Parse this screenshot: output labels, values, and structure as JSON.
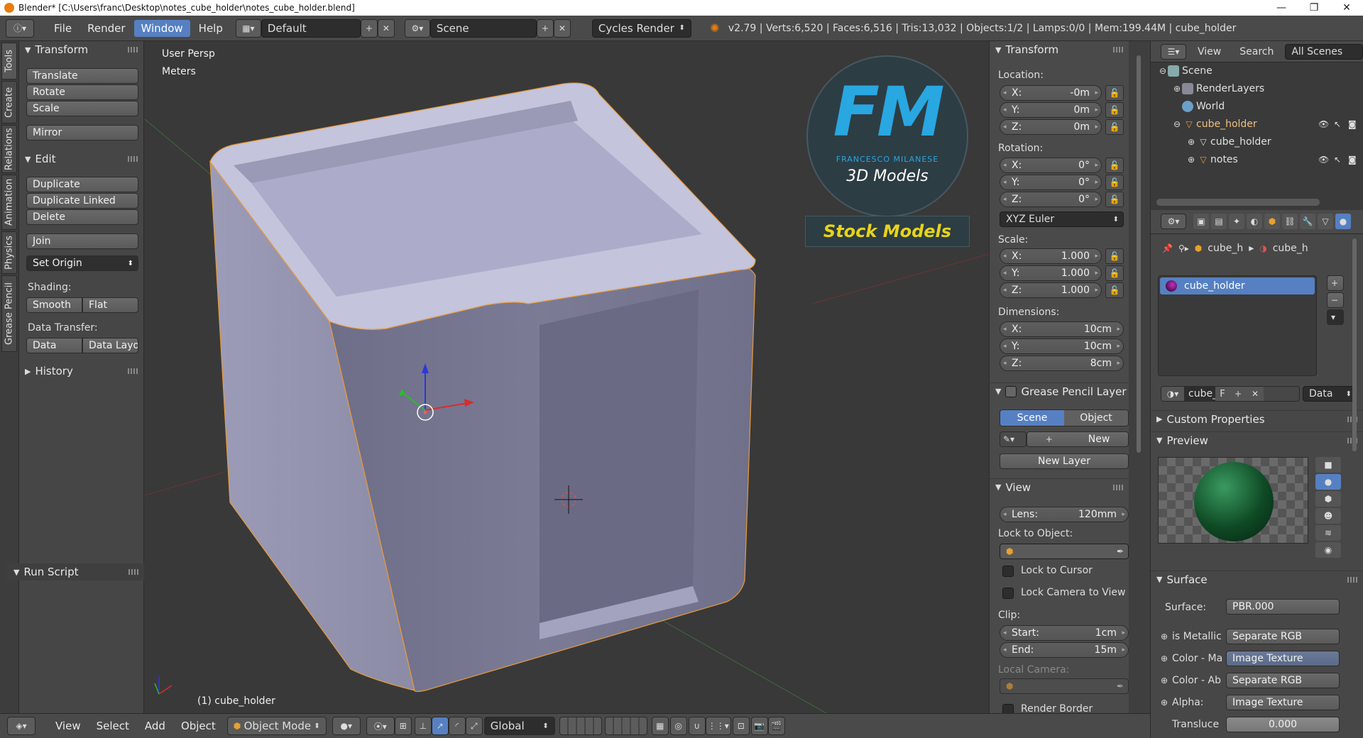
{
  "window": {
    "title": "Blender* [C:\\Users\\franc\\Desktop\\notes_cube_holder\\notes_cube_holder.blend]",
    "minimize": "—",
    "maximize": "❐",
    "close": "✕"
  },
  "topbar": {
    "menus": [
      "File",
      "Render",
      "Window",
      "Help"
    ],
    "active_menu": "Window",
    "layout": "Default",
    "scene": "Scene",
    "engine": "Cycles Render",
    "stats": "v2.79 | Verts:6,520 | Faces:6,516 | Tris:13,032 | Objects:1/2 | Lamps:0/0 | Mem:199.44M | cube_holder"
  },
  "left_tabs": [
    "Tools",
    "Create",
    "Relations",
    "Animation",
    "Physics",
    "Grease Pencil"
  ],
  "toolshelf": {
    "transform_header": "Transform",
    "translate": "Translate",
    "rotate": "Rotate",
    "scale": "Scale",
    "mirror": "Mirror",
    "edit_header": "Edit",
    "duplicate": "Duplicate",
    "duplicate_linked": "Duplicate Linked",
    "delete": "Delete",
    "join": "Join",
    "set_origin": "Set Origin",
    "shading_label": "Shading:",
    "smooth": "Smooth",
    "flat": "Flat",
    "data_transfer_label": "Data Transfer:",
    "data": "Data",
    "data_layout": "Data Layo",
    "history_header": "History",
    "run_script_header": "Run Script"
  },
  "viewport": {
    "view_name": "User Persp",
    "units": "Meters",
    "object_label": "(1) cube_holder",
    "logo_fm": "FM",
    "logo_name": "FRANCESCO MILANESE",
    "logo_3d": "3D Models",
    "logo_stock": "Stock Models"
  },
  "npanel": {
    "transform_header": "Transform",
    "location_label": "Location:",
    "loc": [
      {
        "l": "X:",
        "v": "-0m"
      },
      {
        "l": "Y:",
        "v": "0m"
      },
      {
        "l": "Z:",
        "v": "0m"
      }
    ],
    "rotation_label": "Rotation:",
    "rot": [
      {
        "l": "X:",
        "v": "0°"
      },
      {
        "l": "Y:",
        "v": "0°"
      },
      {
        "l": "Z:",
        "v": "0°"
      }
    ],
    "euler": "XYZ Euler",
    "scale_label": "Scale:",
    "scale": [
      {
        "l": "X:",
        "v": "1.000"
      },
      {
        "l": "Y:",
        "v": "1.000"
      },
      {
        "l": "Z:",
        "v": "1.000"
      }
    ],
    "dimensions_label": "Dimensions:",
    "dims": [
      {
        "l": "X:",
        "v": "10cm"
      },
      {
        "l": "Y:",
        "v": "10cm"
      },
      {
        "l": "Z:",
        "v": "8cm"
      }
    ],
    "grease_header": "Grease Pencil Layer",
    "gp_scene": "Scene",
    "gp_object": "Object",
    "gp_new": "New",
    "gp_new_layer": "New Layer",
    "view_header": "View",
    "lens_label": "Lens:",
    "lens_value": "120mm",
    "lock_to_object": "Lock to Object:",
    "lock_to_cursor": "Lock to Cursor",
    "lock_camera": "Lock Camera to View",
    "clip_label": "Clip:",
    "clip_start_label": "Start:",
    "clip_start": "1cm",
    "clip_end_label": "End:",
    "clip_end": "15m",
    "local_camera": "Local Camera:",
    "render_border": "Render Border"
  },
  "outliner": {
    "view": "View",
    "search": "Search",
    "filter": "All Scenes",
    "items": [
      "Scene",
      "RenderLayers",
      "World",
      "cube_holder",
      "cube_holder",
      "notes"
    ]
  },
  "properties": {
    "breadcrumb_1": "cube_h",
    "breadcrumb_2": "cube_h",
    "material_slot": "cube_holder",
    "mat_name": "cube_",
    "mat_f": "F",
    "data_select": "Data",
    "custom_props": "Custom Properties",
    "preview": "Preview",
    "surface_header": "Surface",
    "surface_label": "Surface:",
    "surface_value": "PBR.000",
    "inputs": [
      {
        "l": "is Metallic",
        "v": "Separate RGB"
      },
      {
        "l": "Color - Ma",
        "v": "Image Texture"
      },
      {
        "l": "Color - Ab",
        "v": "Separate RGB"
      },
      {
        "l": "Alpha:",
        "v": "Image Texture"
      },
      {
        "l": "Transluce",
        "v": "0.000"
      }
    ]
  },
  "bottombar": {
    "view": "View",
    "select": "Select",
    "add": "Add",
    "object": "Object",
    "mode": "Object Mode",
    "orientation": "Global"
  },
  "colors": {
    "accent": "#5680c2",
    "viewport_bg": "#393939",
    "panel_bg": "#4a4a4a",
    "object_color": "#a8a8c6",
    "logo_blue": "#29a7e1",
    "logo_yellow": "#e8d417"
  }
}
